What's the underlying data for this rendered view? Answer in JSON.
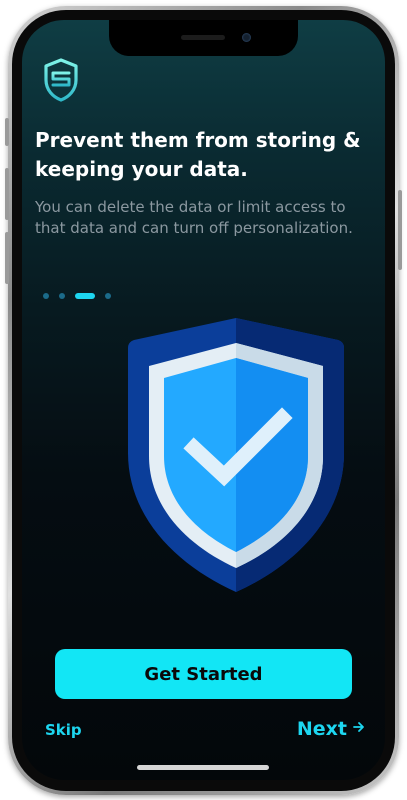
{
  "onboarding": {
    "title": "Prevent them from storing & keeping your data.",
    "description": "You can delete the data or limit access to that data and can turn off personalization.",
    "page_indicator": {
      "total_pages": 4,
      "current_page": 3
    },
    "primary_button_label": "Get Started",
    "skip_label": "Skip",
    "next_label": "Next",
    "next_icon": "arrow-right-icon",
    "logo_icon": "shield-logo-icon",
    "illustration_icon": "shield-check-icon"
  },
  "colors": {
    "accent": "#12e6f5",
    "background_top": "#0f3d44",
    "background_bottom": "#03070a",
    "shield_dark": "#0d3fa0",
    "shield_light": "#1ea7ff"
  }
}
